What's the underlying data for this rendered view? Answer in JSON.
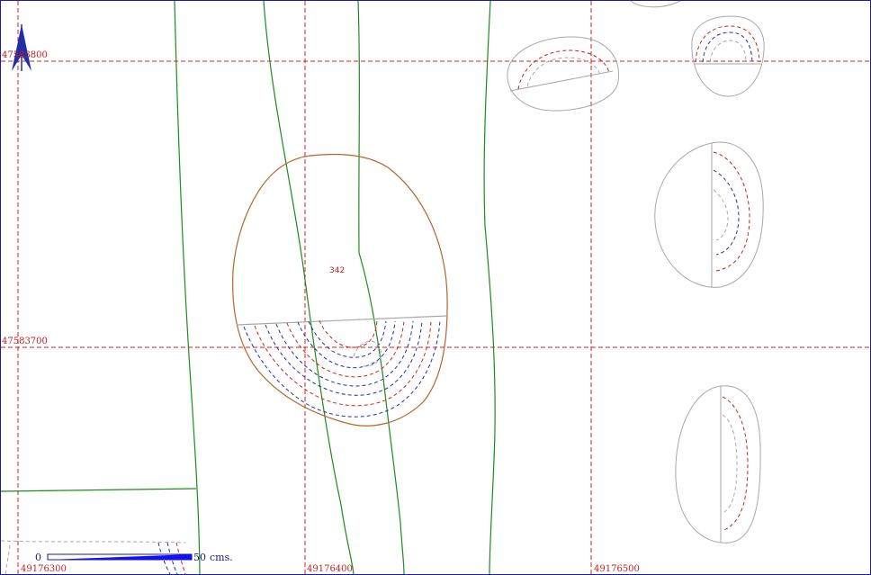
{
  "map": {
    "grid_x_labels": [
      "49176300",
      "49176400",
      "49176500"
    ],
    "grid_y_labels": [
      "47583800",
      "47583700"
    ],
    "feature_label": "342",
    "north_arrow": "north-arrow-icon",
    "colors": {
      "grid": "#d11f1f",
      "contour_green": "#1c8c1c",
      "feature_outline": "#b5652a",
      "hatch_blue": "#1f2fa8",
      "hatch_red": "#d11f1f",
      "pit_outline": "#a8a8a8",
      "border": "#1a1aa8"
    }
  },
  "scale_bar": {
    "start_label": "0",
    "end_label": "50",
    "unit_label": "cms."
  }
}
